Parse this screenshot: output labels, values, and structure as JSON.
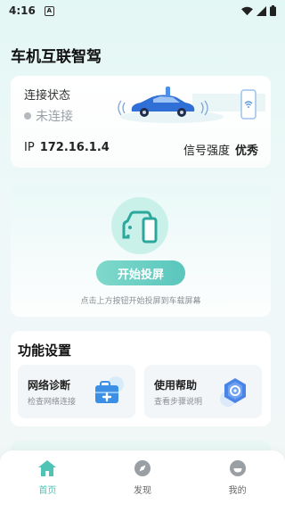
{
  "status_bar": {
    "time": "4:16",
    "notification": "A"
  },
  "app": {
    "title": "车机互联智驾"
  },
  "connection": {
    "label": "连接状态",
    "state": "未连接",
    "ip_label": "IP",
    "ip_value": "172.16.1.4",
    "signal_label": "信号强度",
    "signal_value": "优秀"
  },
  "cast": {
    "button_label": "开始投屏",
    "hint": "点击上方按钮开始投屏到车载屏幕"
  },
  "functions": {
    "title": "功能设置",
    "items": [
      {
        "name": "网络诊断",
        "desc": "检查网络连接",
        "icon": "medkit-icon"
      },
      {
        "name": "使用帮助",
        "desc": "查看步骤说明",
        "icon": "help-hexagon-icon"
      }
    ]
  },
  "tabs": [
    {
      "label": "首页",
      "icon": "home-icon",
      "active": true
    },
    {
      "label": "发现",
      "icon": "compass-icon",
      "active": false
    },
    {
      "label": "我的",
      "icon": "profile-icon",
      "active": false
    }
  ],
  "colors": {
    "accent": "#4fc3b4",
    "accent_light": "#c9f1ea",
    "text": "#1a1a1a"
  }
}
